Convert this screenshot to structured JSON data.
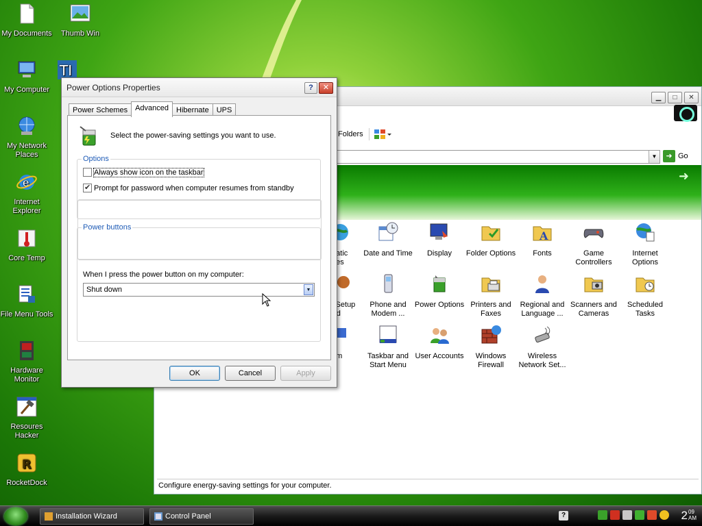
{
  "desktop_icons": [
    {
      "label": "My Documents",
      "icon": "document-icon"
    },
    {
      "label": "Thumb Win",
      "icon": "image-icon"
    },
    {
      "label": "My Computer",
      "icon": "computer-icon"
    },
    {
      "label": "My Network Places",
      "icon": "network-icon"
    },
    {
      "label": "Internet Explorer",
      "icon": "ie-icon"
    },
    {
      "label": "Core Temp",
      "icon": "thermometer-icon"
    },
    {
      "label": "File Menu Tools",
      "icon": "file-tools-icon"
    },
    {
      "label": "Hardware Monitor",
      "icon": "monitor-chip-icon"
    },
    {
      "label": "Resoures Hacker",
      "icon": "hammer-icon"
    },
    {
      "label": "RocketDock",
      "icon": "rocketdock-icon"
    }
  ],
  "control_panel": {
    "toolbar": {
      "folders_label": "Folders"
    },
    "address": {
      "go_label": "Go"
    },
    "items": [
      {
        "label": "matic\nates"
      },
      {
        "label": "Date and Time"
      },
      {
        "label": "Display"
      },
      {
        "label": "Folder Options"
      },
      {
        "label": "Fonts"
      },
      {
        "label": "Game\nControllers"
      },
      {
        "label": "Internet\nOptions"
      },
      {
        "label": "k Setup\nard"
      },
      {
        "label": "Phone and\nModem ..."
      },
      {
        "label": "Power Options"
      },
      {
        "label": "Printers and\nFaxes"
      },
      {
        "label": "Regional and\nLanguage ..."
      },
      {
        "label": "Scanners and\nCameras"
      },
      {
        "label": "Scheduled\nTasks"
      },
      {
        "label": "tem"
      },
      {
        "label": "Taskbar and\nStart Menu"
      },
      {
        "label": "User Accounts"
      },
      {
        "label": "Windows\nFirewall"
      },
      {
        "label": "Wireless\nNetwork Set..."
      }
    ],
    "status": "Configure energy-saving settings for your computer."
  },
  "dialog": {
    "title": "Power Options Properties",
    "help": "?",
    "close": "✕",
    "tabs": [
      {
        "label": "Power Schemes",
        "active": false
      },
      {
        "label": "Advanced",
        "active": true
      },
      {
        "label": "Hibernate",
        "active": false
      },
      {
        "label": "UPS",
        "active": false
      }
    ],
    "intro": "Select the power-saving settings you want to use.",
    "options_group": {
      "label": "Options",
      "checkboxes": [
        {
          "label": "Always show icon on the taskbar",
          "checked": false
        },
        {
          "label": "Prompt for password when computer resumes from standby",
          "checked": true
        }
      ]
    },
    "power_buttons_group": {
      "label": "Power buttons",
      "prompt": "When I press the power button on my computer:",
      "selected": "Shut down"
    },
    "buttons": {
      "ok": "OK",
      "cancel": "Cancel",
      "apply": "Apply"
    }
  },
  "taskbar": {
    "buttons": [
      {
        "label": "Installation Wizard"
      },
      {
        "label": "Control Panel"
      }
    ],
    "clock_hour": "2",
    "clock_minute": "09",
    "clock_ampm": "AM"
  }
}
